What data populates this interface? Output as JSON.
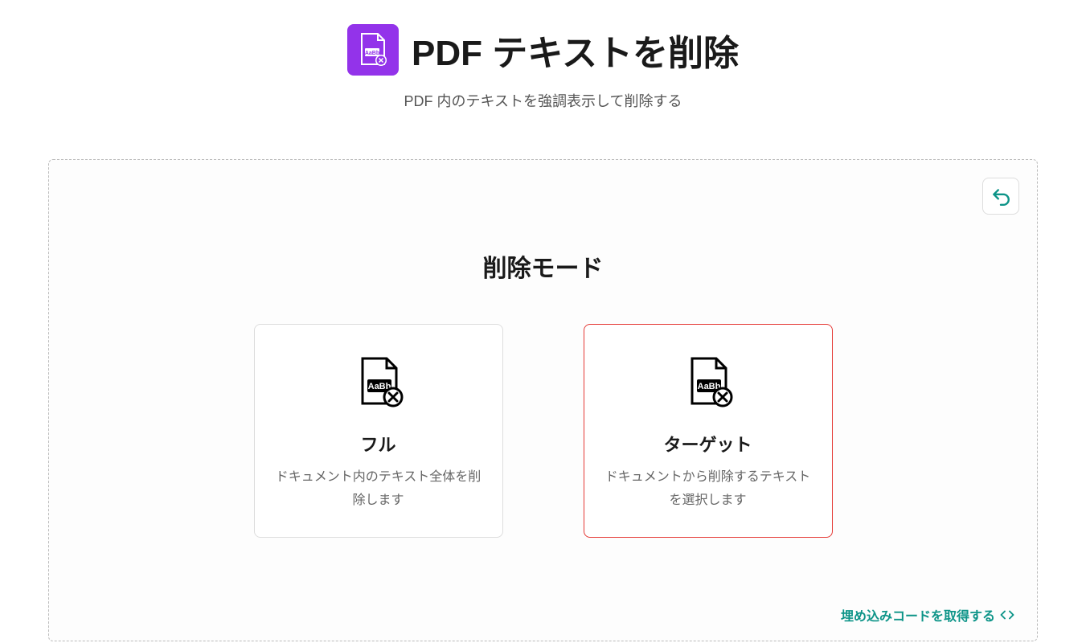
{
  "header": {
    "title": "PDF テキストを削除",
    "subtitle": "PDF 内のテキストを強調表示して削除する"
  },
  "panel": {
    "section_title": "削除モード",
    "options": [
      {
        "title": "フル",
        "desc": "ドキュメント内のテキスト全体を削除します",
        "selected": false
      },
      {
        "title": "ターゲット",
        "desc": "ドキュメントから削除するテキストを選択します",
        "selected": true
      }
    ],
    "embed_link": "埋め込みコードを取得する"
  },
  "colors": {
    "accent": "#9333ea",
    "teal": "#0d9488",
    "selected_border": "#e53935"
  }
}
